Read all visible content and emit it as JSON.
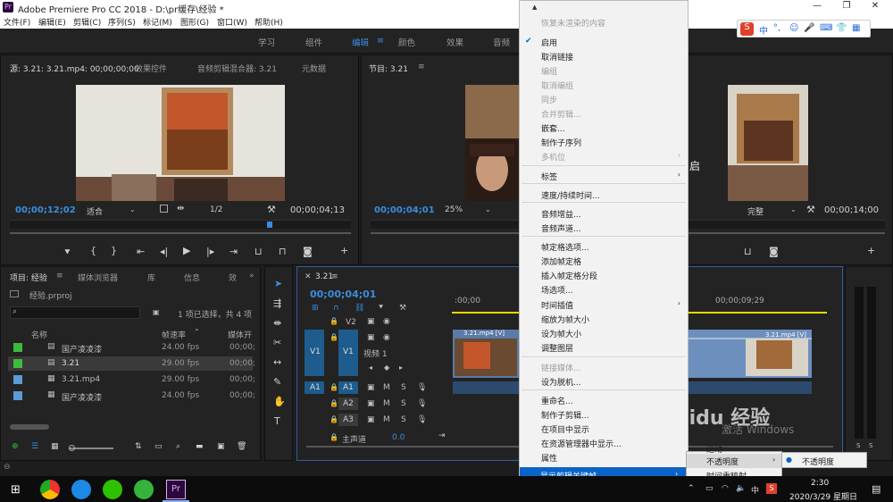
{
  "titlebar": {
    "title": "Adobe Premiere Pro CC 2018 - D:\\pr缓存\\经验 *",
    "logo": "Pr",
    "minimize": "—",
    "restore": "❐",
    "close": "✕"
  },
  "menu": [
    "文件(F)",
    "编辑(E)",
    "剪辑(C)",
    "序列(S)",
    "标记(M)",
    "图形(G)",
    "窗口(W)",
    "帮助(H)"
  ],
  "workspaces": [
    "学习",
    "组件",
    "编辑",
    "颜色",
    "效果",
    "音频"
  ],
  "source_panel": {
    "tabs": [
      "源: 3.21: 3.21.mp4: 00;00;00;00",
      "效果控件",
      "音频剪辑混合器: 3.21",
      "元数据"
    ],
    "timecode_left": "00;00;12;02",
    "fit": "适合",
    "fraction": "1/2",
    "timecode_right": "00;00;04;13"
  },
  "program_panel": {
    "tab": "节目: 3.21",
    "timecode_left": "00;00;04;01",
    "zoom": "25%",
    "quality": "完整",
    "timecode_right": "00;00;14;00"
  },
  "project_panel": {
    "tabs": [
      "项目: 经验",
      "媒体浏览器",
      "库",
      "信息",
      "效"
    ],
    "file": "经验.prproj",
    "selection_info": "1 项已选择，共 4 项",
    "columns": [
      "名称",
      "帧速率",
      "媒体开"
    ],
    "rows": [
      {
        "color": "#3dbb3d",
        "name": "国产凌凌漆",
        "fps": "24.00 fps",
        "start": "00;00;"
      },
      {
        "color": "#3dbb3d",
        "name": "3.21",
        "fps": "29.00 fps",
        "start": "00;00;"
      },
      {
        "color": "#5b9bd5",
        "name": "3.21.mp4",
        "fps": "29.00 fps",
        "start": "00;00;"
      },
      {
        "color": "#5b9bd5",
        "name": "国产凌凌漆",
        "fps": "24.00 fps",
        "start": "00;00;"
      }
    ]
  },
  "timeline": {
    "tab": "3.21",
    "timecode": "00;00;04;01",
    "ruler_start": ":00;00",
    "ruler_mid": "00;00;09;29",
    "tracks": [
      {
        "src": "",
        "name": "V2",
        "label": ""
      },
      {
        "src": "V1",
        "name": "V1",
        "label": "视频 1"
      },
      {
        "src": "A1",
        "name": "A1",
        "label": ""
      },
      {
        "src": "",
        "name": "A2",
        "label": ""
      },
      {
        "src": "",
        "name": "A3",
        "label": ""
      }
    ],
    "master_label": "主声道",
    "master_value": "0.0",
    "clip1": "3.21.mp4 [V]",
    "clip2": "3.21.mp4 [V]",
    "fx_m": "M",
    "fx_s": "S"
  },
  "context_menu": {
    "top_arrow": "▲",
    "bottom_arrow": "▼",
    "items": [
      {
        "label": "恢复未渲染的内容",
        "disabled": true
      },
      {
        "label": "启用",
        "checked": true
      },
      {
        "label": "取消链接"
      },
      {
        "label": "编组",
        "disabled": true
      },
      {
        "label": "取消编组",
        "disabled": true
      },
      {
        "label": "同步",
        "disabled": true
      },
      {
        "label": "合并剪辑...",
        "disabled": true
      },
      {
        "label": "嵌套..."
      },
      {
        "label": "制作子序列"
      },
      {
        "label": "多机位",
        "disabled": true,
        "submenu": true
      },
      {
        "label": "标签",
        "submenu": true
      },
      {
        "label": "速度/持续时间..."
      },
      {
        "label": "音频增益..."
      },
      {
        "label": "音频声道..."
      },
      {
        "label": "帧定格选项..."
      },
      {
        "label": "添加帧定格"
      },
      {
        "label": "插入帧定格分段"
      },
      {
        "label": "场选项..."
      },
      {
        "label": "时间插值",
        "submenu": true
      },
      {
        "label": "缩放为帧大小"
      },
      {
        "label": "设为帧大小"
      },
      {
        "label": "调整图层"
      },
      {
        "label": "链接媒体...",
        "disabled": true
      },
      {
        "label": "设为脱机..."
      },
      {
        "label": "重命名..."
      },
      {
        "label": "制作子剪辑..."
      },
      {
        "label": "在项目中显示"
      },
      {
        "label": "在资源管理器中显示..."
      },
      {
        "label": "属性"
      },
      {
        "label": "显示剪辑关键帧",
        "submenu": true,
        "highlighted": true
      }
    ]
  },
  "submenu1": {
    "items": [
      "运动",
      "不透明度",
      "时间重映射"
    ]
  },
  "submenu2": {
    "item": "不透明度"
  },
  "overlay_text": "激活 Windows",
  "watermark": "Baidu 经验",
  "ime": {
    "label": "中"
  },
  "taskbar": {
    "time": "2:30",
    "date": "2020/3/29 星期日",
    "ime": "中"
  }
}
